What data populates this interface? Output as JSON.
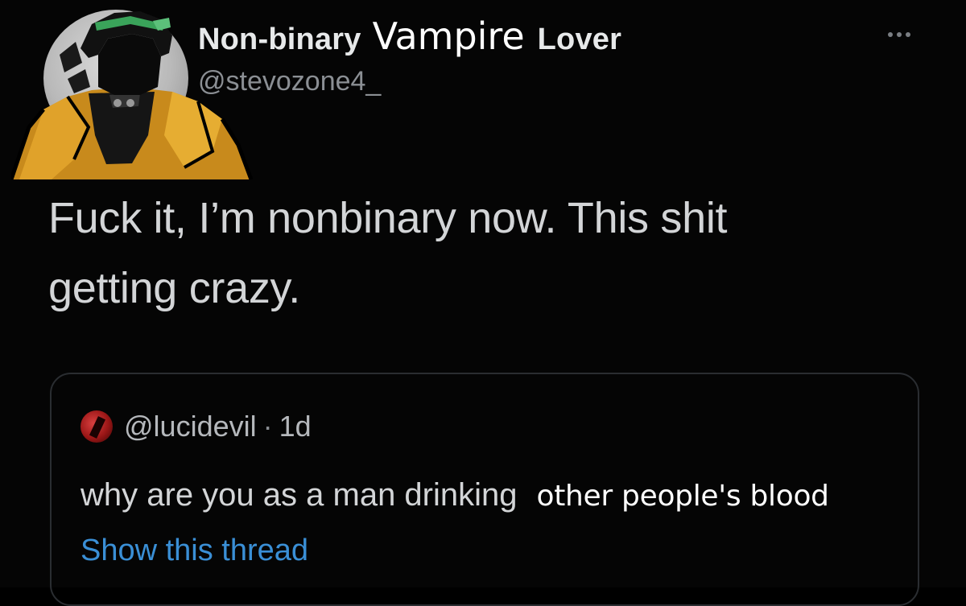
{
  "author": {
    "display_name_a": "Non-binary",
    "display_name_b": "Vampire",
    "display_name_c": "Lover",
    "handle": "@stevozone4_",
    "avatar_icon": "anime-character-avatar-icon"
  },
  "tweet": {
    "text_line1": "Fuck it, I’m nonbinary now. This shit",
    "text_line2": "getting crazy."
  },
  "menu": {
    "icon": "more-options-icon"
  },
  "quoted_tweet": {
    "handle": "@lucidevil",
    "separator": "·",
    "time": "1d",
    "text_a": "why are you as a man drinking",
    "text_b": "other people's blood",
    "show_thread_label": "Show this thread",
    "avatar_icon": "red-avatar-icon"
  },
  "colors": {
    "background": "#050505",
    "primary_text": "#e7e9ea",
    "secondary_text": "#8b8f94",
    "link": "#3a8fd6",
    "card_border": "#2a2d31"
  }
}
